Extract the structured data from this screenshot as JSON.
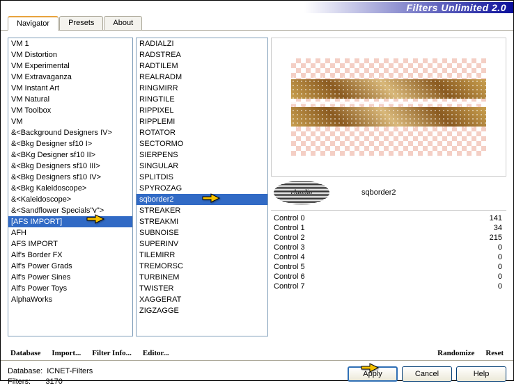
{
  "title": "Filters Unlimited 2.0",
  "tabs": {
    "navigator": "Navigator",
    "presets": "Presets",
    "about": "About",
    "active": "Navigator"
  },
  "categories": [
    "VM 1",
    "VM Distortion",
    "VM Experimental",
    "VM Extravaganza",
    "VM Instant Art",
    "VM Natural",
    "VM Toolbox",
    "VM",
    "&<Background Designers IV>",
    "&<Bkg Designer sf10 I>",
    "&<BKg Designer sf10 II>",
    "&<Bkg Designers sf10 III>",
    "&<Bkg Designers sf10 IV>",
    "&<Bkg Kaleidoscope>",
    "&<Kaleidoscope>",
    "&<Sandflower Specials\"v\">",
    "[AFS IMPORT]",
    "AFH",
    "AFS IMPORT",
    "Alf's Border FX",
    "Alf's Power Grads",
    "Alf's Power Sines",
    "Alf's Power Toys",
    "AlphaWorks"
  ],
  "categories_selected": "[AFS IMPORT]",
  "filters": [
    "RADIALZI",
    "RADSTREA",
    "RADTILEM",
    "REALRADM",
    "RINGMIRR",
    "RINGTILE",
    "RIPPIXEL",
    "RIPPLEMI",
    "ROTATOR",
    "SECTORMO",
    "SIERPENS",
    "SINGULAR",
    "SPLITDIS",
    "SPYROZAG",
    "sqborder2",
    "STREAKER",
    "STREAKMI",
    "SUBNOISE",
    "SUPERINV",
    "TILEMIRR",
    "TREMORSC",
    "TURBINEM",
    "TWISTER",
    "XAGGERAT",
    "ZIGZAGGE"
  ],
  "filters_selected": "sqborder2",
  "current_filter": "sqborder2",
  "controls": [
    {
      "name": "Control 0",
      "value": 141
    },
    {
      "name": "Control 1",
      "value": 34
    },
    {
      "name": "Control 2",
      "value": 215
    },
    {
      "name": "Control 3",
      "value": 0
    },
    {
      "name": "Control 4",
      "value": 0
    },
    {
      "name": "Control 5",
      "value": 0
    },
    {
      "name": "Control 6",
      "value": 0
    },
    {
      "name": "Control 7",
      "value": 0
    }
  ],
  "buttons": {
    "database": "Database",
    "import": "Import...",
    "filter_info": "Filter Info...",
    "editor": "Editor...",
    "randomize": "Randomize",
    "reset": "Reset",
    "apply": "Apply",
    "cancel": "Cancel",
    "help": "Help"
  },
  "footer": {
    "db_label": "Database:",
    "db_value": "ICNET-Filters",
    "filters_label": "Filters:",
    "filters_value": "3170"
  },
  "badge_text": "claudia"
}
